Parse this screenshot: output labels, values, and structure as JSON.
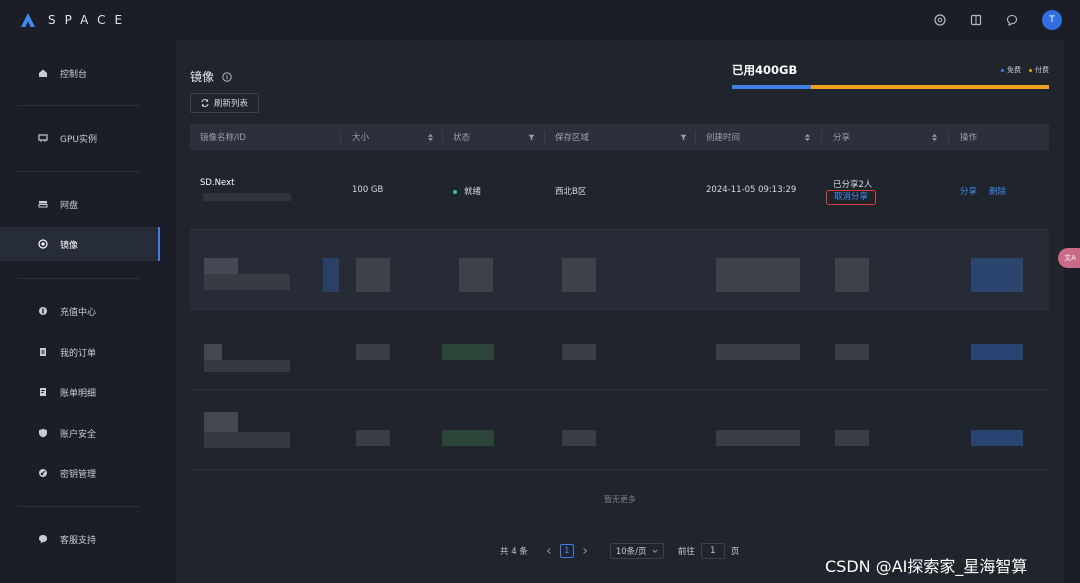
{
  "app": {
    "logo_text": "SPACE",
    "avatar_letter": "T"
  },
  "sidebar": {
    "items": [
      {
        "label": "控制台",
        "icon": "home-icon"
      },
      {
        "label": "GPU实例",
        "icon": "gpu-icon"
      },
      {
        "label": "网盘",
        "icon": "disk-icon"
      },
      {
        "label": "镜像",
        "icon": "target-icon",
        "active": true
      },
      {
        "label": "充值中心",
        "icon": "wallet-icon"
      },
      {
        "label": "我的订单",
        "icon": "order-icon"
      },
      {
        "label": "账单明细",
        "icon": "bill-icon"
      },
      {
        "label": "账户安全",
        "icon": "shield-icon"
      },
      {
        "label": "密钥管理",
        "icon": "key-icon"
      },
      {
        "label": "客服支持",
        "icon": "chat-icon"
      }
    ]
  },
  "main": {
    "title": "镜像",
    "refresh_label": "刷新列表",
    "usage": {
      "label": "已用400GB",
      "legend_free": "免费",
      "legend_paid": "付费",
      "free_color": "#3d7fe6",
      "paid_color": "#f0a020",
      "free_fraction": 0.25,
      "paid_fraction": 0.75
    },
    "table": {
      "headers": [
        "镜像名称/ID",
        "大小",
        "状态",
        "保存区域",
        "创建时间",
        "分享",
        "操作"
      ],
      "row": {
        "name": "SD.Next",
        "size": "100 GB",
        "status": "就绪",
        "region": "西北B区",
        "created": "2024-11-05 09:13:29",
        "shared": "已分享2人",
        "cancel_share": "取消分享",
        "action_share": "分享",
        "action_delete": "删除"
      }
    },
    "empty_note": "暂无更多",
    "pager": {
      "total": "共 4 条",
      "current": "1",
      "page_size": "10条/页",
      "goto": "前往",
      "goto_value": "1",
      "page_unit": "页"
    }
  },
  "float_tag": "文A",
  "watermark": "CSDN @AI探索家_星海智算"
}
